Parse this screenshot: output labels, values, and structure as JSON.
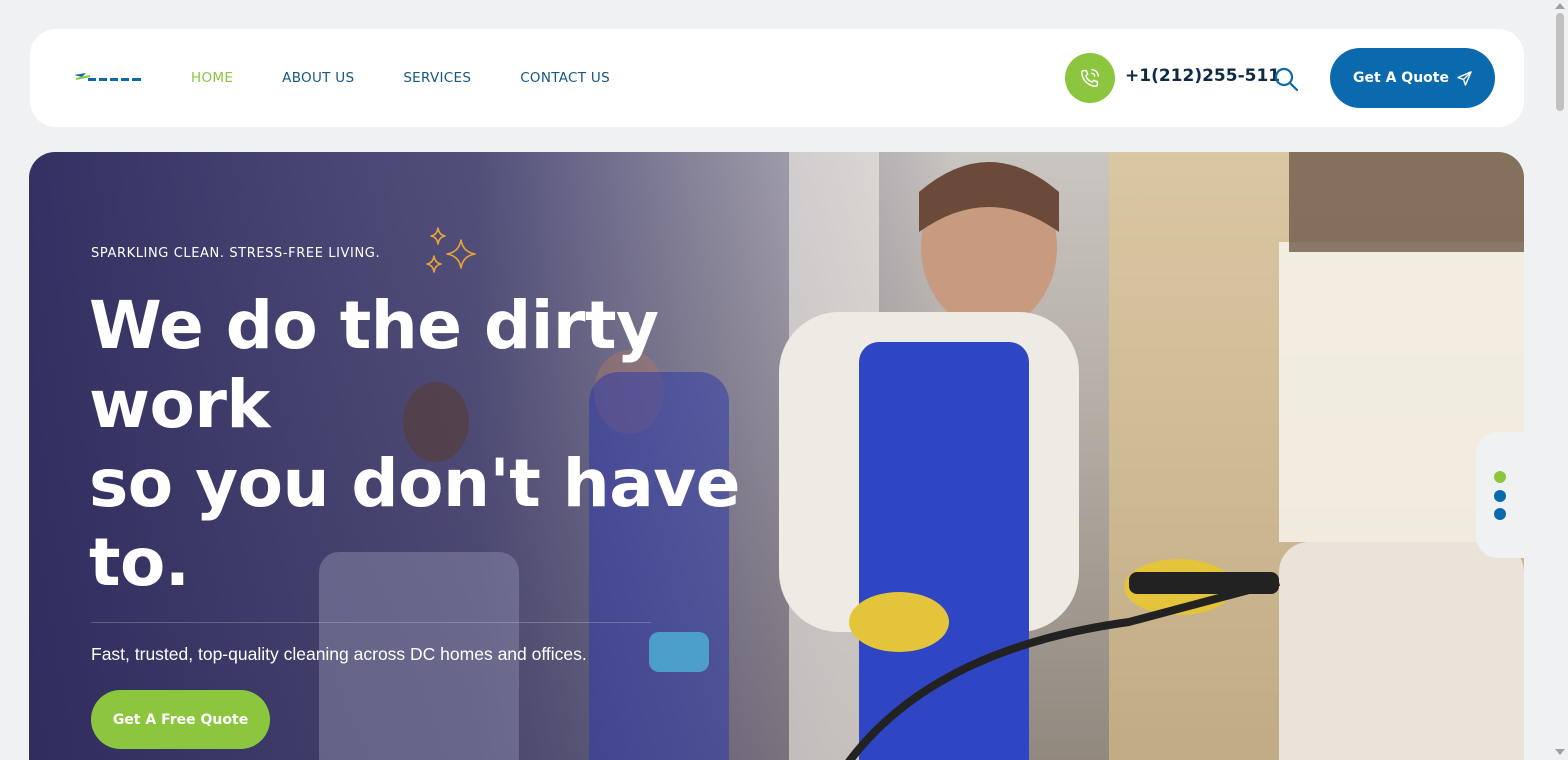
{
  "header": {
    "logo_alt": "Bruce",
    "nav": [
      {
        "label": "HOME",
        "active": true
      },
      {
        "label": "ABOUT US",
        "active": false
      },
      {
        "label": "SERVICES",
        "active": false
      },
      {
        "label": "CONTACT US",
        "active": false
      }
    ],
    "phone": "+1(212)255-511",
    "phone_icon": "phone-icon",
    "search_icon": "search-icon",
    "quote_button": "Get A Quote",
    "quote_icon": "paper-plane-icon"
  },
  "hero": {
    "tagline": "SPARKLING CLEAN. STRESS-FREE LIVING.",
    "headline_lines": [
      "We do the dirty",
      "work",
      "so you don't have",
      "to."
    ],
    "subtext": "Fast, trusted, top-quality cleaning across DC homes and offices.",
    "cta": "Get A Free Quote",
    "sparkle_icon": "sparkles-icon",
    "slides": [
      {
        "active": true
      },
      {
        "active": false
      },
      {
        "active": false
      }
    ]
  },
  "colors": {
    "accent_green": "#8cc63f",
    "brand_blue": "#0b6aad",
    "nav_blue": "#14577f",
    "dark_text": "#0f2a44",
    "hero_overlay": "#28265c"
  }
}
